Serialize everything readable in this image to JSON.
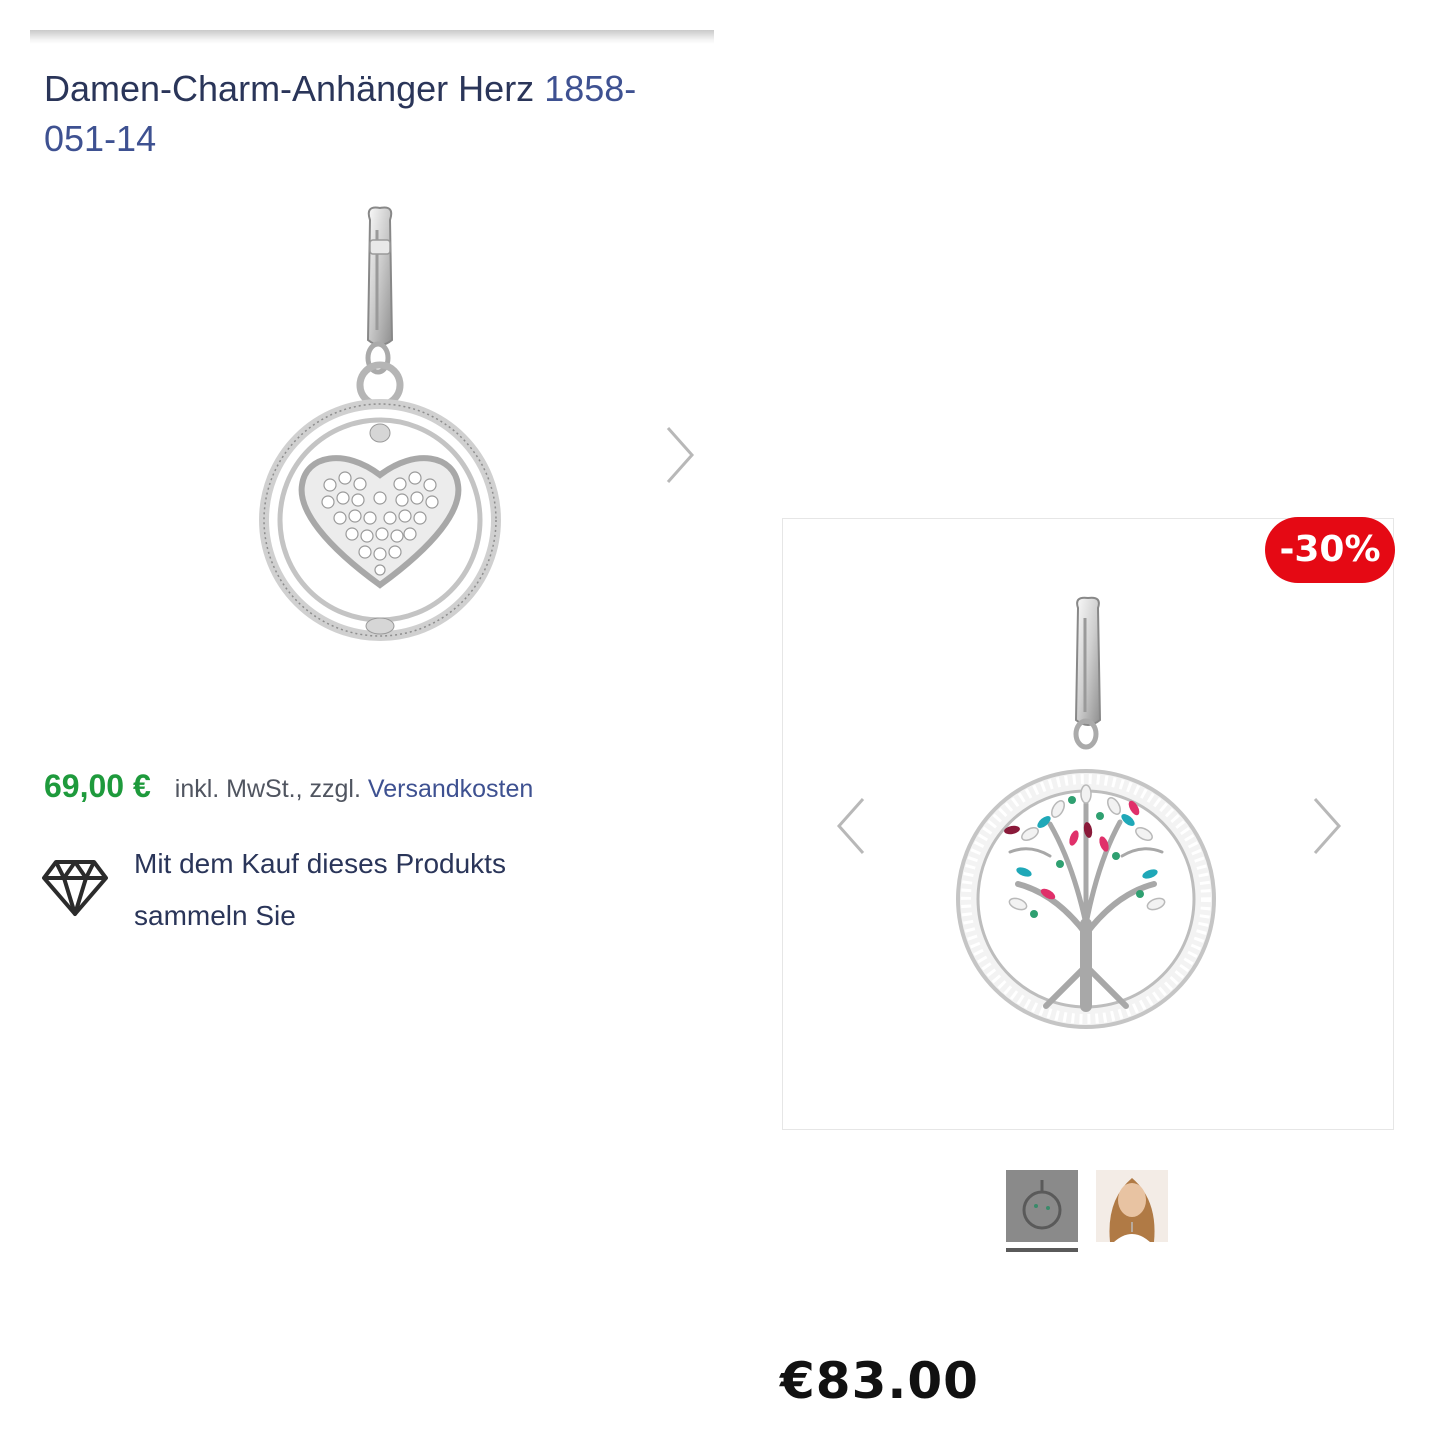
{
  "left": {
    "title": "Damen-Charm-Anhänger Herz ",
    "sku": "1858-051-14",
    "price": "69,00 €",
    "price_note": "inkl. MwSt., zzgl.",
    "shipping_link": "Versandkosten",
    "loyalty_text": "Mit dem Kauf dieses Produkts sammeln Sie"
  },
  "right": {
    "discount_badge": "-30%",
    "price": "€83.00",
    "thumbnails": [
      "product-thumbnail",
      "model-thumbnail"
    ],
    "selected_thumbnail": 0
  },
  "colors": {
    "title": "#2a3559",
    "link": "#3e5191",
    "price_green": "#1e9a3c",
    "badge_red": "#e50914"
  },
  "icons": [
    "chevron-right-icon",
    "chevron-left-icon",
    "diamond-icon"
  ]
}
